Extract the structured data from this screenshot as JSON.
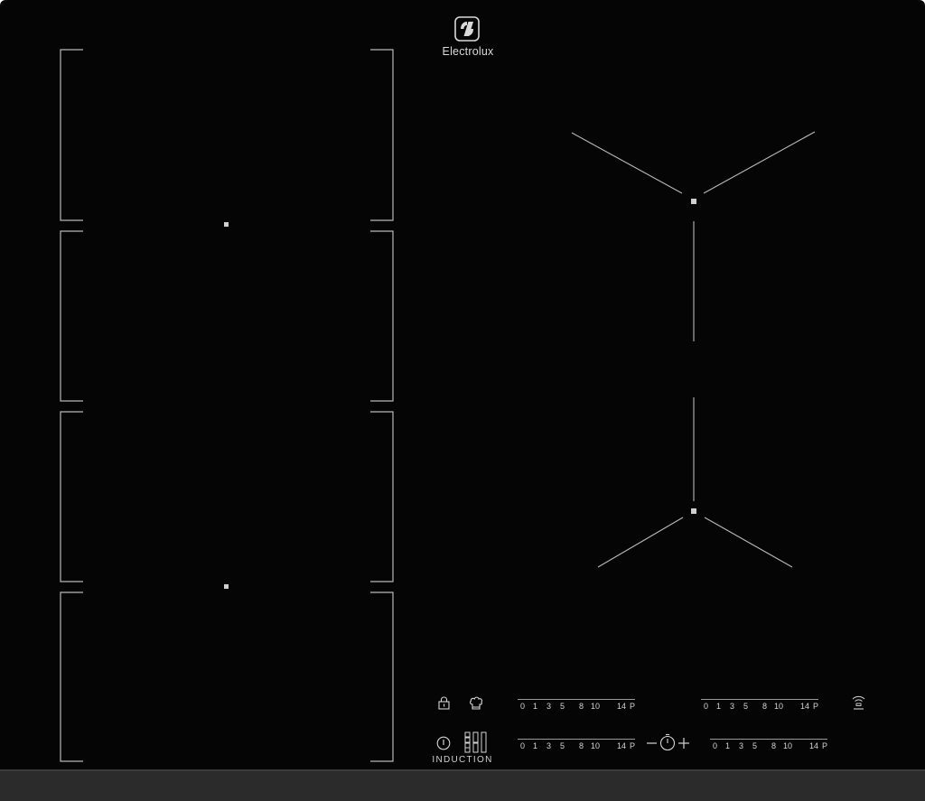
{
  "brand": {
    "name": "Electrolux",
    "logo_icon": "electrolux-logo-icon"
  },
  "hob": {
    "surface_color": "#050505",
    "frame_bottom_color": "#2b2b2b",
    "line_color": "#b8b8b8",
    "flex_zone_count": 4,
    "right_zone_count": 2
  },
  "power_scale": {
    "ticks": [
      "0",
      "1",
      "3",
      "5",
      "8",
      "10",
      "14",
      "P"
    ]
  },
  "controls": {
    "lock_icon": "lock-icon",
    "chef_icon": "chef-hat-icon",
    "power_icon": "power-icon",
    "bridge_icon": "bridge-zones-icon",
    "timer_icon": "timer-icon",
    "minus_icon": "minus-icon",
    "plus_icon": "plus-icon",
    "hob2hood_icon": "hob2hood-icon",
    "induction_label": "INDUCTION"
  }
}
